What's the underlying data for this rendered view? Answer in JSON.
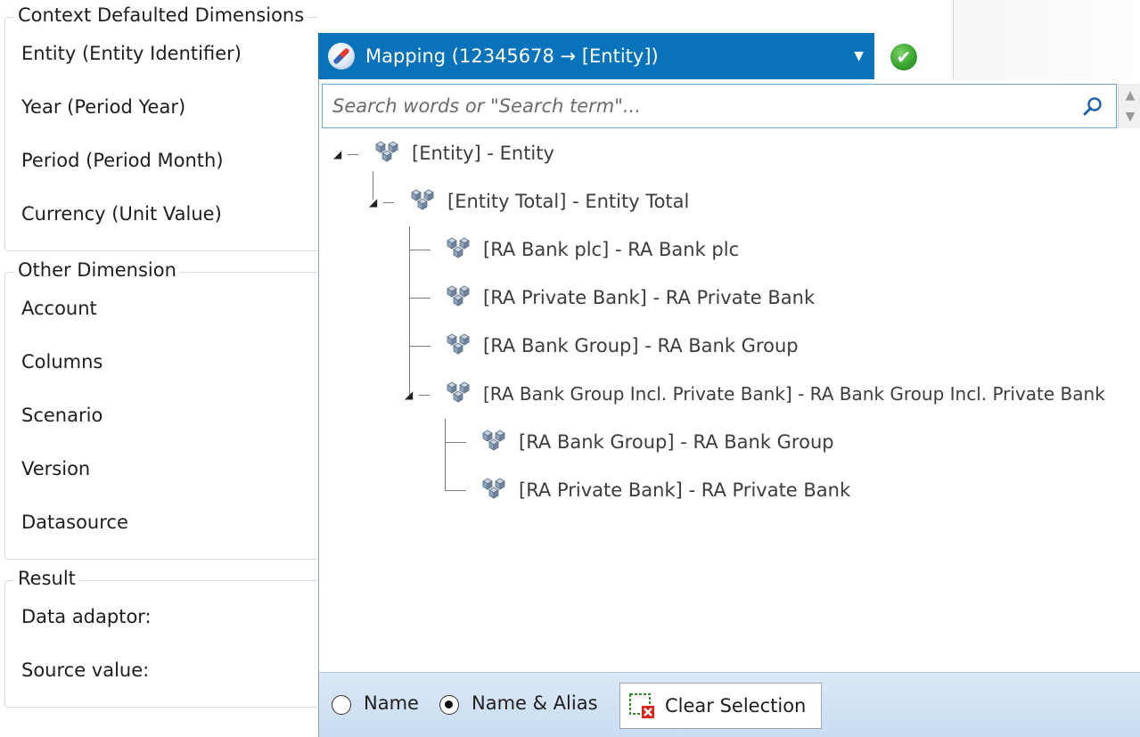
{
  "sections": {
    "context": {
      "title": "Context Defaulted Dimensions",
      "rows": [
        "Entity (Entity Identifier)",
        "Year (Period Year)",
        "Period (Period Month)",
        "Currency (Unit Value)"
      ]
    },
    "other": {
      "title": "Other Dimension",
      "rows": [
        "Account",
        "Columns",
        "Scenario",
        "Version",
        "Datasource"
      ]
    },
    "result": {
      "title": "Result",
      "rows": [
        "Data adaptor:",
        "Source value:"
      ]
    }
  },
  "combo": {
    "icon": "compass-icon",
    "selected": "Mapping (12345678 → [Entity])",
    "arrow": "▼"
  },
  "ok_icon": "check-icon",
  "search": {
    "placeholder": "Search words or \"Search term\"...",
    "icon": "search-icon"
  },
  "tree": [
    {
      "label": "[Entity] - Entity",
      "level": 0,
      "expanded": true
    },
    {
      "label": "[Entity Total] - Entity Total",
      "level": 1,
      "expanded": true
    },
    {
      "label": "[RA Bank plc] - RA Bank plc",
      "level": 2,
      "expanded": false
    },
    {
      "label": "[RA Private Bank] - RA Private Bank",
      "level": 2,
      "expanded": false
    },
    {
      "label": "[RA Bank Group] - RA Bank Group",
      "level": 2,
      "expanded": false
    },
    {
      "label": "[RA Bank Group Incl. Private Bank] - RA Bank Group Incl. Private Bank",
      "level": 2,
      "expanded": true
    },
    {
      "label": "[RA Bank Group] - RA Bank Group",
      "level": 3,
      "expanded": false
    },
    {
      "label": "[RA Private Bank] - RA Private Bank",
      "level": 3,
      "expanded": false
    }
  ],
  "footer": {
    "radio_name": "Name",
    "radio_name_alias": "Name & Alias",
    "selected": "Name & Alias",
    "clear_label": "Clear Selection"
  },
  "colors": {
    "accent": "#0873bb",
    "ok": "#34a02a",
    "footer_bg": "#d3e2f4"
  }
}
